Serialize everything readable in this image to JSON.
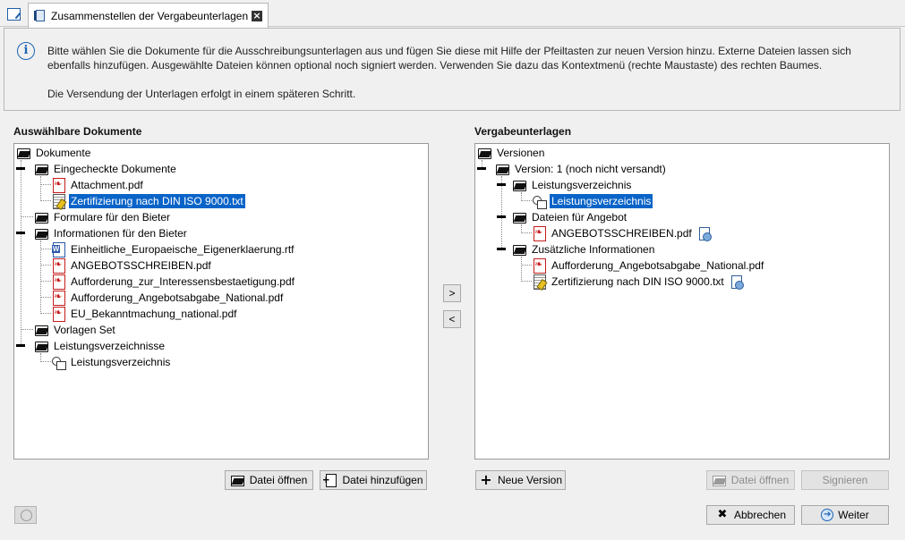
{
  "tab": {
    "title": "Zusammenstellen der Vergabeunterlagen",
    "close_label": "×"
  },
  "info": {
    "paragraph1": "Bitte wählen Sie die Dokumente für die Ausschreibungsunterlagen aus und fügen Sie diese mit Hilfe der Pfeiltasten zur neuen Version hinzu. Externe Dateien lassen sich ebenfalls hinzufügen. Ausgewählte Dateien können optional noch signiert werden. Verwenden Sie dazu das Kontextmenü (rechte Maustaste) des rechten Baumes.",
    "paragraph2": "Die Versendung der Unterlagen erfolgt in einem späteren Schritt."
  },
  "left": {
    "title": "Auswählbare Dokumente",
    "nodes": [
      {
        "label": "Dokumente",
        "icon": "folder-icon"
      },
      {
        "label": "Eingecheckte Dokumente",
        "icon": "folder-icon"
      },
      {
        "label": "Attachment.pdf",
        "icon": "pdf-icon"
      },
      {
        "label": "Zertifizierung nach DIN ISO 9000.txt",
        "icon": "text-file-icon",
        "selected": true
      },
      {
        "label": "Formulare für den Bieter",
        "icon": "folder-icon"
      },
      {
        "label": "Informationen für den Bieter",
        "icon": "folder-icon"
      },
      {
        "label": "Einheitliche_Europaeische_Eigenerklaerung.rtf",
        "icon": "word-document-icon"
      },
      {
        "label": "ANGEBOTSSCHREIBEN.pdf",
        "icon": "pdf-icon"
      },
      {
        "label": "Aufforderung_zur_Interessensbestaetigung.pdf",
        "icon": "pdf-icon"
      },
      {
        "label": "Aufforderung_Angebotsabgabe_National.pdf",
        "icon": "pdf-icon"
      },
      {
        "label": "EU_Bekanntmachung_national.pdf",
        "icon": "pdf-icon"
      },
      {
        "label": "Vorlagen Set",
        "icon": "folder-icon"
      },
      {
        "label": "Leistungsverzeichnisse",
        "icon": "folder-icon"
      },
      {
        "label": "Leistungsverzeichnis",
        "icon": "specification-icon"
      }
    ],
    "open_button": "Datei öffnen",
    "add_button": "Datei hinzufügen"
  },
  "arrows": {
    "add": ">",
    "remove": "<"
  },
  "right": {
    "title": "Vergabeunterlagen",
    "nodes": [
      {
        "label": "Versionen",
        "icon": "folder-icon"
      },
      {
        "label": "Version: 1 (noch nicht versandt)",
        "icon": "folder-icon"
      },
      {
        "label": "Leistungsverzeichnis",
        "icon": "folder-icon"
      },
      {
        "label": "Leistungsverzeichnis",
        "icon": "specification-icon",
        "selected": true
      },
      {
        "label": "Dateien für Angebot",
        "icon": "folder-icon"
      },
      {
        "label": "ANGEBOTSSCHREIBEN.pdf",
        "icon": "pdf-icon",
        "signed": true
      },
      {
        "label": "Zusätzliche Informationen",
        "icon": "folder-icon"
      },
      {
        "label": "Aufforderung_Angebotsabgabe_National.pdf",
        "icon": "pdf-icon"
      },
      {
        "label": "Zertifizierung nach DIN ISO 9000.txt",
        "icon": "text-file-icon",
        "signed": true
      }
    ],
    "new_version_button": "Neue Version",
    "open_button": "Datei öffnen",
    "sign_button": "Signieren"
  },
  "footer": {
    "cancel_button": "Abbrechen",
    "next_button": "Weiter"
  },
  "colors": {
    "selection": "#0a64c8",
    "info_icon": "#1c64b4",
    "pdf": "#c61c1c"
  }
}
